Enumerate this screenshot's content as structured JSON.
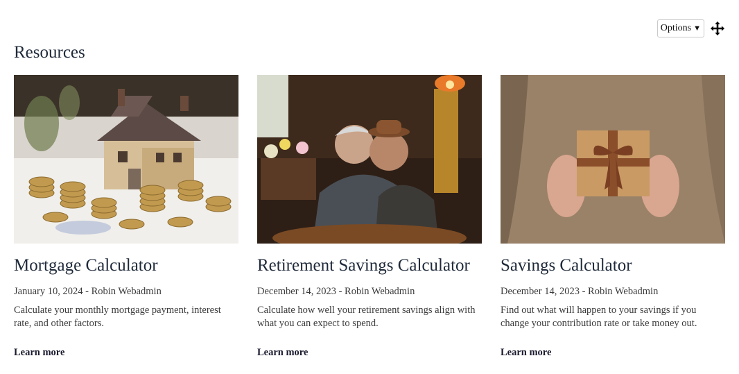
{
  "toolbar": {
    "options_label": "Options",
    "move_icon": "move-arrows-icon"
  },
  "section": {
    "title": "Resources"
  },
  "cards": [
    {
      "title": "Mortgage Calculator",
      "date": "January 10, 2024",
      "separator": "-",
      "author": "Robin Webadmin",
      "description": "Calculate your monthly mortgage payment, interest rate, and other factors.",
      "link": "Learn more"
    },
    {
      "title": "Retirement Savings Calculator",
      "date": "December 14, 2023",
      "separator": "-",
      "author": "Robin Webadmin",
      "description": "Calculate how well your retirement savings align with what you can expect to spend.",
      "link": "Learn more"
    },
    {
      "title": "Savings Calculator",
      "date": "December 14, 2023",
      "separator": "-",
      "author": "Robin Webadmin",
      "description": "Find out what will happen to your savings if you change your contribution rate or take money out.",
      "link": "Learn more"
    }
  ]
}
